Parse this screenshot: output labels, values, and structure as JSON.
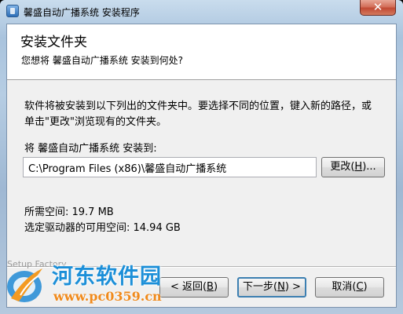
{
  "window": {
    "title": "馨盛自动广播系统 安装程序",
    "close_symbol": "✕"
  },
  "header": {
    "title": "安装文件夹",
    "subtitle": "您想将 馨盛自动广播系统 安装到何处?"
  },
  "main": {
    "description": "软件将被安装到以下列出的文件夹中。要选择不同的位置，键入新的路径，或单击\"更改\"浏览现有的文件夹。",
    "install_label": "将 馨盛自动广播系统 安装到:",
    "install_path": "C:\\Program Files (x86)\\馨盛自动广播系统",
    "change_button_text": "更改(",
    "change_button_key": "H",
    "change_button_tail": ")...",
    "space_required": "所需空间: 19.7 MB",
    "space_available": "选定驱动器的可用空间: 14.94 GB"
  },
  "footer": {
    "brand": "Setup Factory",
    "back_text": "< 返回(",
    "back_key": "B",
    "back_tail": ")",
    "next_text": "下一步(",
    "next_key": "N",
    "next_tail": ") >",
    "cancel_text": "取消(",
    "cancel_key": "C",
    "cancel_tail": ")"
  },
  "watermark": {
    "name": "河东软件园",
    "url": "www.pc0359.cn"
  },
  "icons": {
    "app": "installer-icon",
    "close": "close-icon",
    "watermark": "watermark-logo-icon"
  }
}
